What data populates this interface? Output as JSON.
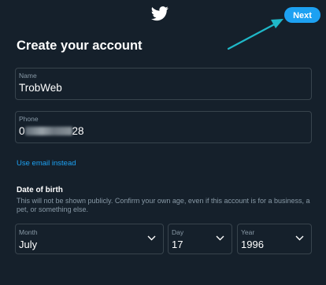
{
  "header": {
    "logo_icon": "twitter-bird-icon",
    "next_label": "Next",
    "accent": "#1da1f2",
    "annotation_arrow_color": "#1fb8c8"
  },
  "form": {
    "title": "Create your account",
    "name": {
      "label": "Name",
      "value": "TrobWeb"
    },
    "phone": {
      "label": "Phone",
      "value_prefix": "0",
      "value_suffix": "28"
    },
    "email_link": "Use email instead",
    "dob": {
      "heading": "Date of birth",
      "note": "This will not be shown publicly. Confirm your own age, even if this account is for a business, a pet, or something else.",
      "month": {
        "label": "Month",
        "value": "July"
      },
      "day": {
        "label": "Day",
        "value": "17"
      },
      "year": {
        "label": "Year",
        "value": "1996"
      }
    }
  }
}
